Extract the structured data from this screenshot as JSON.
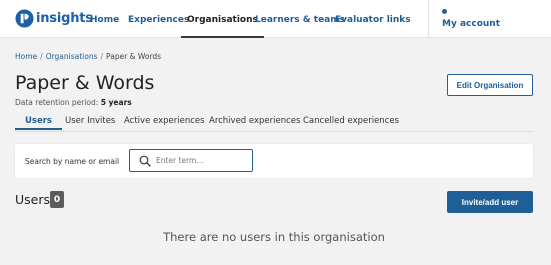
{
  "brand": {
    "name": "insights",
    "color": "#1d5fa8"
  },
  "nav": {
    "items": [
      {
        "label": "Home",
        "active": false
      },
      {
        "label": "Experiences",
        "active": false
      },
      {
        "label": "Organisations",
        "active": true
      },
      {
        "label": "Learners & teams",
        "active": false
      },
      {
        "label": "Evaluator links",
        "active": false
      }
    ],
    "account": "My account"
  },
  "breadcrumb": [
    "Home",
    "Organisations",
    "Paper & Words"
  ],
  "page": {
    "title": "Paper & Words",
    "retention_label": "Data retention period:",
    "retention_value": "5 years",
    "edit_button": "Edit Organisation"
  },
  "tabs": [
    {
      "label": "Users",
      "active": true
    },
    {
      "label": "User Invites",
      "active": false
    },
    {
      "label": "Active experiences",
      "active": false
    },
    {
      "label": "Archived experiences",
      "active": false
    },
    {
      "label": "Cancelled experiences",
      "active": false
    }
  ],
  "search": {
    "label": "Search by name or email",
    "placeholder": "Enter term...",
    "value": ""
  },
  "users": {
    "title": "Users",
    "count": "0",
    "invite_button": "Invite/add user",
    "empty_message": "There are no users in this organisation"
  },
  "colors": {
    "accent": "#1f5e96",
    "background": "#f2f2f2",
    "count_badge": "#5c5c5c"
  }
}
